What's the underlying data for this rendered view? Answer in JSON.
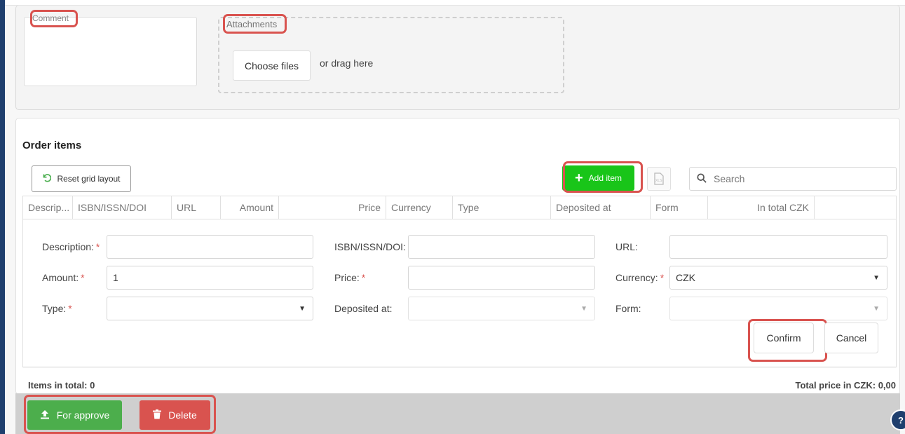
{
  "top": {
    "comment_label": "Comment",
    "attachments_label": "Attachments",
    "choose_files": "Choose files",
    "drag_text": "or drag here"
  },
  "order": {
    "title": "Order items",
    "reset_label": "Reset grid layout",
    "add_label": "Add item",
    "search_placeholder": "Search",
    "columns": [
      "Descrip...",
      "ISBN/ISSN/DOI",
      "URL",
      "Amount",
      "Price",
      "Currency",
      "Type",
      "Deposited at",
      "Form",
      "In total CZK"
    ]
  },
  "form": {
    "description_label": "Description:",
    "isbn_label": "ISBN/ISSN/DOI:",
    "url_label": "URL:",
    "amount_label": "Amount:",
    "amount_value": "1",
    "price_label": "Price:",
    "currency_label": "Currency:",
    "currency_value": "CZK",
    "type_label": "Type:",
    "deposited_label": "Deposited at:",
    "form_label": "Form:",
    "required_mark": "*",
    "confirm": "Confirm",
    "cancel": "Cancel"
  },
  "footer": {
    "items_total": "Items in total: 0",
    "total_price": "Total price in CZK: 0,00"
  },
  "actions": {
    "approve": "For approve",
    "delete": "Delete",
    "help": "?"
  },
  "colors": {
    "add_green": "#19c519",
    "approve_green": "#4cae4c",
    "delete_red": "#d9534f",
    "highlight_red": "#d9534f",
    "nav_blue": "#1f3f6e"
  },
  "icons": {
    "reset": "undo-icon",
    "add": "plus-icon",
    "export": "xlsx-export-icon",
    "search": "search-icon",
    "approve": "upload-icon",
    "delete": "trash-icon",
    "help": "question-icon",
    "dropdown": "caret-down-icon"
  }
}
